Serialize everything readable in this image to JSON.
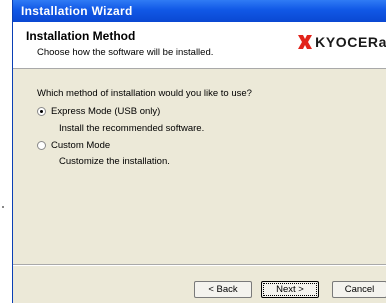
{
  "window": {
    "title": "Installation Wizard"
  },
  "header": {
    "title": "Installation Method",
    "subtitle": "Choose how the software will be installed.",
    "logo_text": "KYOCERa",
    "logo_color": "#e2231a"
  },
  "main": {
    "question": "Which method of installation would you like to use?",
    "options": [
      {
        "label": "Express Mode (USB only)",
        "description": "Install the recommended software.",
        "selected": true
      },
      {
        "label": "Custom Mode",
        "description": "Customize the installation.",
        "selected": false
      }
    ]
  },
  "footer": {
    "back_label": "< Back",
    "next_label": "Next >",
    "cancel_label": "Cancel"
  }
}
